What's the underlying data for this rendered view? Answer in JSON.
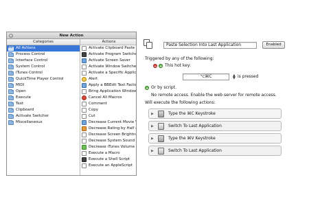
{
  "window": {
    "title": "New Action"
  },
  "left": {
    "categories_header": "Categories",
    "actions_header": "Actions",
    "categories": [
      "All Actions",
      "Process Control",
      "Interface Control",
      "System Control",
      "iTunes Control",
      "QuickTime Player Control",
      "MIDI",
      "Open",
      "Execute",
      "Text",
      "Clipboard",
      "Activate Switcher",
      "Miscellaneous"
    ],
    "actions": [
      "Activate Clipboard Paste Swi",
      "Activate Program Switcher",
      "Activate Screen Saver",
      "Activate Window Switcher",
      "Activate a Specific Applicatio",
      "Alert",
      "Apply a BBEdit Text Factory",
      "Bring Application Windows t",
      "Cancel All Macros",
      "Comment",
      "Copy",
      "Cut",
      "Decrease Current Movie Vol",
      "Decrease Rating by Half a St",
      "Decrease Screen Brightness",
      "Decrease System Sound Volu",
      "Decrease iTunes Volume",
      "Execute a Macro",
      "Execute a Shell Script",
      "Execute an AppleScript"
    ],
    "action_icons": [
      "clipboard-icon",
      "switcher-icon",
      "screensaver-icon",
      "window-icon",
      "app-icon",
      "alert-icon",
      "bbedit-icon",
      "app-window-icon",
      "cancel-icon",
      "comment-icon",
      "copy-icon",
      "cut-icon",
      "quicktime-icon",
      "rating-icon",
      "brightness-icon",
      "volume-icon",
      "itunes-icon",
      "macro-icon",
      "terminal-icon",
      "applescript-icon"
    ]
  },
  "editor": {
    "macro_name": "Paste Selection Into Last Application",
    "enabled_label": "Enabled",
    "triggered_label": "Triggered by any of the following:",
    "hotkey_label": "This hot key:",
    "hotkey_value": "⌥⌘C",
    "hotkey_mode": "is pressed",
    "or_by_script": "Or by script.",
    "remote_text": "No remote access.  Enable the web server for remote access.",
    "will_execute": "Will execute the following actions:",
    "actions": [
      {
        "label": "Type the ⌘C Keystroke",
        "kind": "keystroke"
      },
      {
        "label": "Switch To Last Application",
        "kind": "switch"
      },
      {
        "label": "Type the ⌘V Keystroke",
        "kind": "keystroke"
      },
      {
        "label": "Switch To Last Application",
        "kind": "switch"
      }
    ]
  }
}
